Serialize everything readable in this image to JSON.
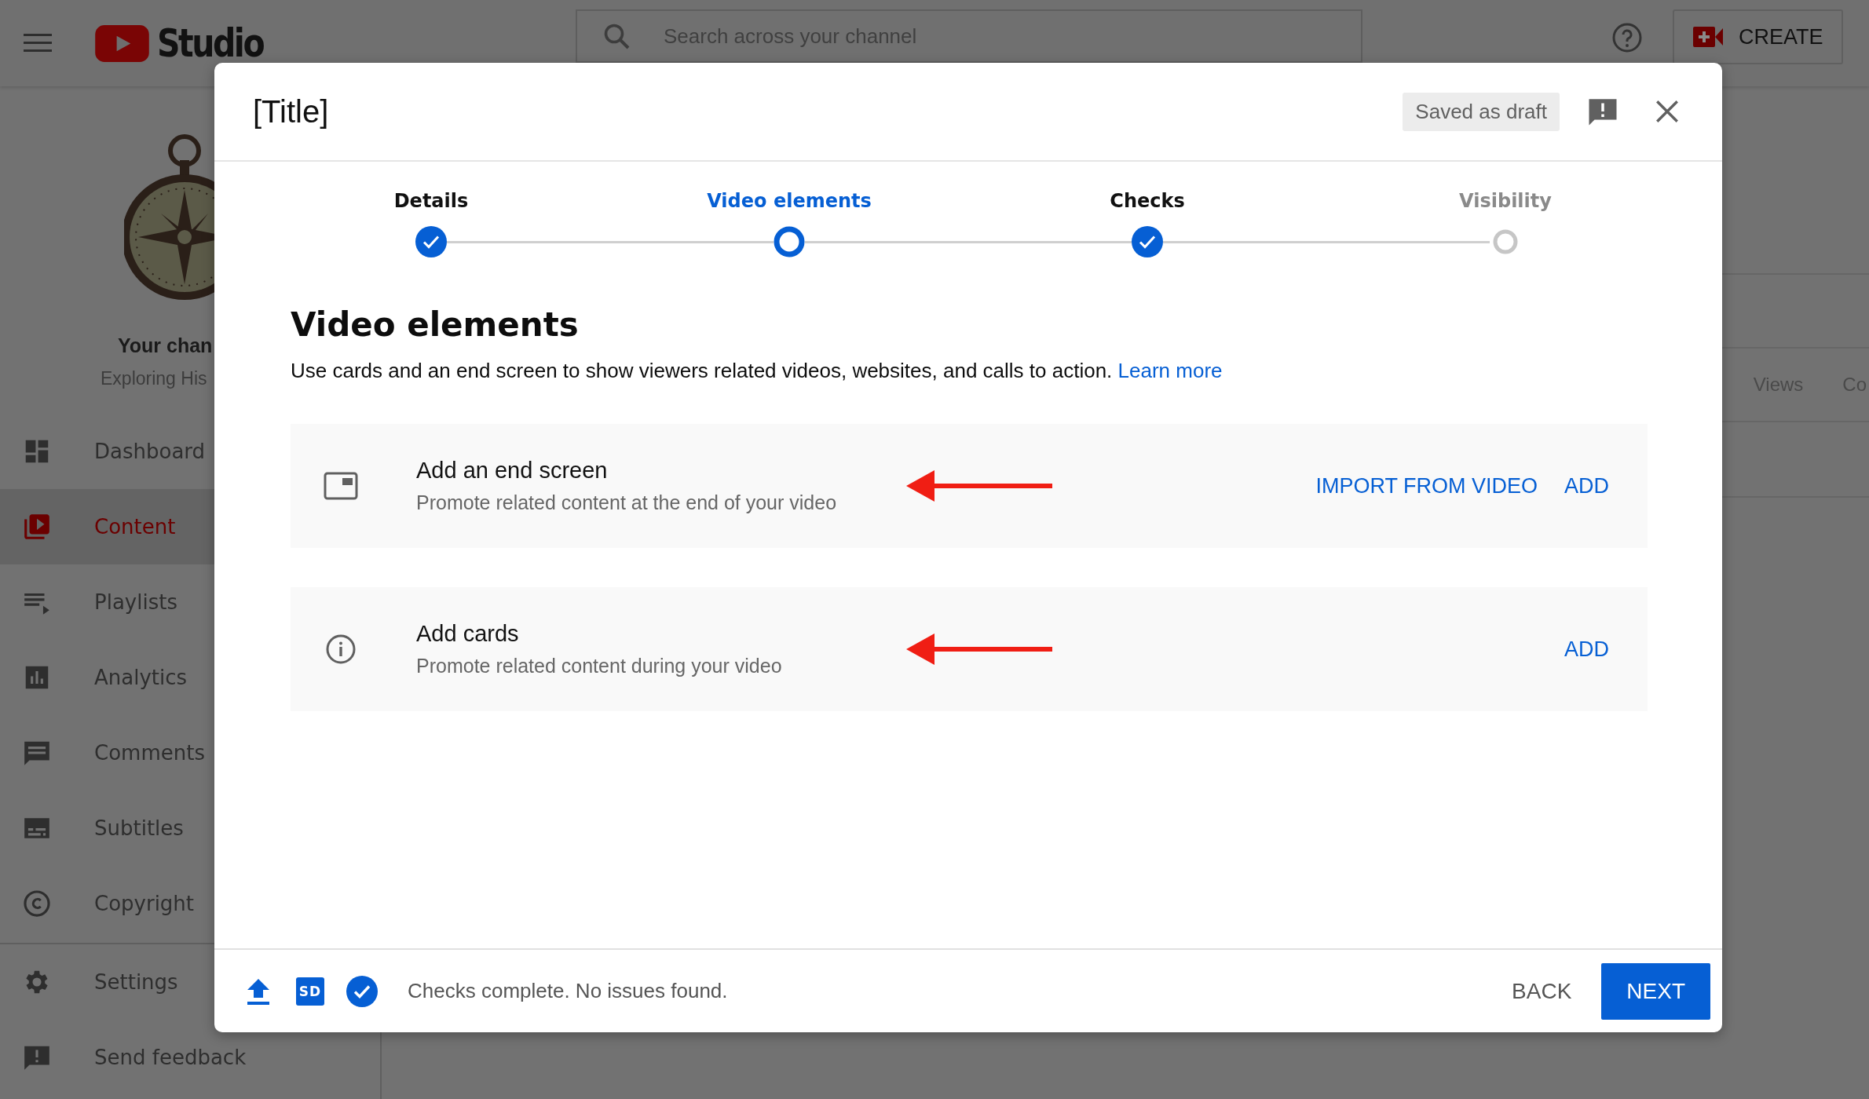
{
  "topbar": {
    "logo_text": "Studio",
    "search": {
      "placeholder": "Search across your channel"
    },
    "create_button": "CREATE"
  },
  "channel": {
    "name": "Your chan",
    "subtitle": "Exploring His"
  },
  "sidebar": {
    "items": [
      {
        "label": "Dashboard",
        "selected": false
      },
      {
        "label": "Content",
        "selected": true
      },
      {
        "label": "Playlists",
        "selected": false
      },
      {
        "label": "Analytics",
        "selected": false
      },
      {
        "label": "Comments",
        "selected": false
      },
      {
        "label": "Subtitles",
        "selected": false
      },
      {
        "label": "Copyright",
        "selected": false
      }
    ],
    "bottom_items": [
      {
        "label": "Settings",
        "selected": false
      },
      {
        "label": "Send feedback",
        "selected": false
      }
    ]
  },
  "table": {
    "columns": [
      "Views",
      "Co"
    ]
  },
  "dialog": {
    "title": "[Title]",
    "status_chip": "Saved as draft",
    "steps": [
      {
        "label": "Details",
        "completed": true,
        "selected": false
      },
      {
        "label": "Video elements",
        "completed": false,
        "selected": true
      },
      {
        "label": "Checks",
        "completed": true,
        "selected": false
      },
      {
        "label": "Visibility",
        "completed": false,
        "selected": false
      }
    ],
    "heading": "Video elements",
    "description": "Use cards and an end screen to show viewers related videos, websites, and calls to action.",
    "learn_more": "Learn more",
    "elements": [
      {
        "kind": "end_screen",
        "title": "Add an end screen",
        "subtitle": "Promote related content at the end of your video",
        "actions": [
          "IMPORT FROM VIDEO",
          "ADD"
        ],
        "annotated": true
      },
      {
        "kind": "cards",
        "title": "Add cards",
        "subtitle": "Promote related content during your video",
        "actions": [
          "ADD"
        ],
        "annotated": true
      }
    ],
    "footer": {
      "quality_badge": "SD",
      "status": "Checks complete. No issues found.",
      "back": "BACK",
      "next": "NEXT"
    }
  }
}
